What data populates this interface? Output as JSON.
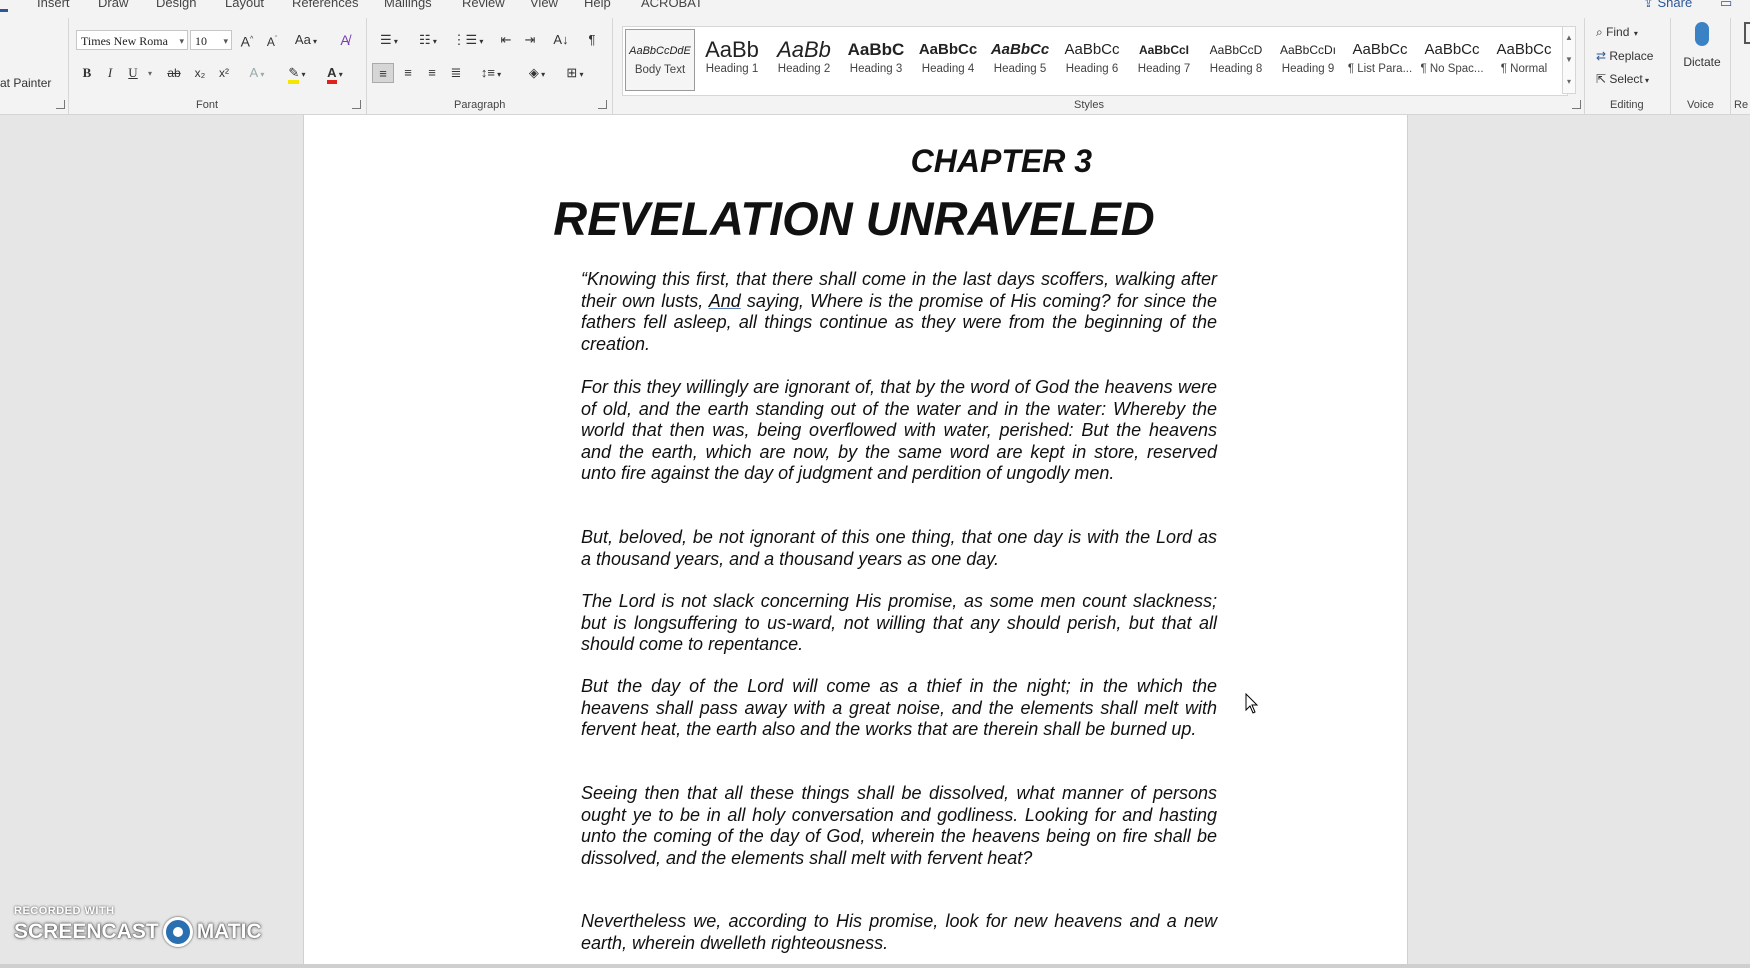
{
  "tabs": [
    "Insert",
    "Draw",
    "Design",
    "Layout",
    "References",
    "Mailings",
    "Review",
    "View",
    "Help",
    "ACROBAT"
  ],
  "top_buttons": {
    "share": "Share"
  },
  "clipboard": {
    "format_painter": "at Painter"
  },
  "font": {
    "name": "Times New Roma",
    "size": "10",
    "grow": "A˄",
    "shrink": "A˅",
    "case": "Aa",
    "bold": "B",
    "italic": "I",
    "underline": "U",
    "strike": "ab",
    "subscript": "x₂",
    "superscript": "x²",
    "group_label": "Font"
  },
  "paragraph": {
    "group_label": "Paragraph"
  },
  "styles": {
    "group_label": "Styles",
    "items": [
      {
        "sample": "AaBbCcDdE",
        "name": "Body Text"
      },
      {
        "sample": "AaBb",
        "name": "Heading 1"
      },
      {
        "sample": "AaBb",
        "name": "Heading 2"
      },
      {
        "sample": "AaBbC",
        "name": "Heading 3"
      },
      {
        "sample": "AaBbCc",
        "name": "Heading 4"
      },
      {
        "sample": "AaBbCc",
        "name": "Heading 5"
      },
      {
        "sample": "AaBbCc",
        "name": "Heading 6"
      },
      {
        "sample": "AaBbCcI",
        "name": "Heading 7"
      },
      {
        "sample": "AaBbCcD",
        "name": "Heading 8"
      },
      {
        "sample": "AaBbCcDı",
        "name": "Heading 9"
      },
      {
        "sample": "AaBbCc",
        "name": "¶ List Para..."
      },
      {
        "sample": "AaBbCc",
        "name": "¶ No Spac..."
      },
      {
        "sample": "AaBbCc",
        "name": "¶ Normal"
      }
    ]
  },
  "editing": {
    "find": "Find",
    "replace": "Replace",
    "select": "Select",
    "group_label": "Editing"
  },
  "voice": {
    "dictate": "Dictate",
    "group_label": "Voice"
  },
  "more_group": "Re",
  "document": {
    "chapter": "CHAPTER 3",
    "title": "REVELATION UNRAVELED",
    "p1_a": "“Knowing this first, that there shall come in the last days scoffers, walking after their own lusts, ",
    "p1_u": "And",
    "p1_b": " saying, Where is the promise of His coming? for since the fathers fell asleep, all things continue as they were from the beginning of the creation.",
    "p2": " For this they willingly are ignorant of, that by the word of God the heavens were of old, and the earth standing out of the water and in the water: Whereby the world that then was, being overflowed with water, perished: But the heavens and the earth, which are now, by the same word are kept in store, reserved unto fire against the day of judgment and perdition of ungodly men.",
    "p3": "But, beloved, be not ignorant of this one thing, that one day is with the Lord as a thousand years, and a thousand years as one day.",
    "p4": "The Lord is not slack concerning His promise, as some men count slackness; but is longsuffering to us-ward, not willing that any should perish, but that all should come to repentance.",
    "p5": "But the day of the Lord will come as a thief in the night; in the which the heavens shall pass away with a great noise, and the elements shall melt with fervent heat, the earth also and the works that are therein shall be burned up.",
    "p6": "Seeing then that all these things shall be dissolved, what manner of persons ought ye to be in all holy conversation and godliness. Looking for and hasting unto the coming of the day of God, wherein the heavens being on fire shall be dissolved, and the elements shall melt with fervent heat?",
    "p7": "Nevertheless we, according to His promise, look for new heavens and a new earth, wherein dwelleth righteousness."
  },
  "watermark": {
    "top": "RECORDED WITH",
    "left": "SCREENCAST",
    "right": "MATIC"
  }
}
